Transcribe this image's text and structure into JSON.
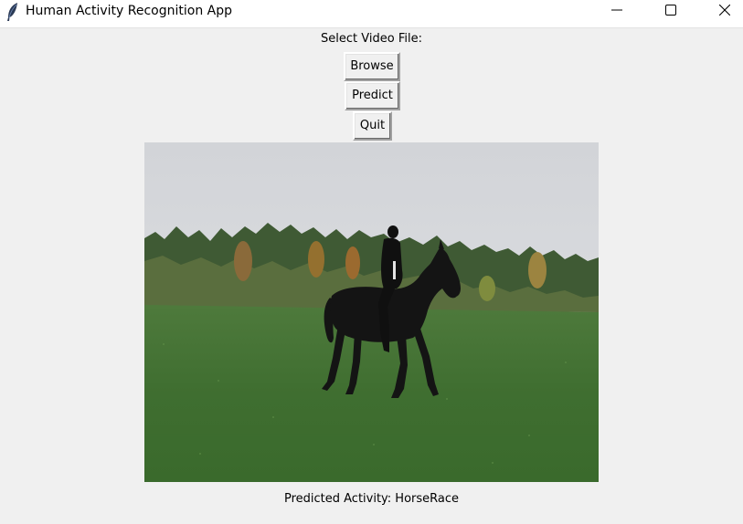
{
  "window": {
    "title": "Human Activity Recognition App"
  },
  "form": {
    "select_label": "Select Video File:",
    "browse_label": "Browse",
    "predict_label": "Predict",
    "quit_label": "Quit"
  },
  "result": {
    "predicted_text": "Predicted Activity: HorseRace"
  },
  "icons": {
    "app": "feather-icon",
    "minimize": "minimize-icon",
    "maximize": "maximize-icon",
    "close": "close-icon"
  }
}
